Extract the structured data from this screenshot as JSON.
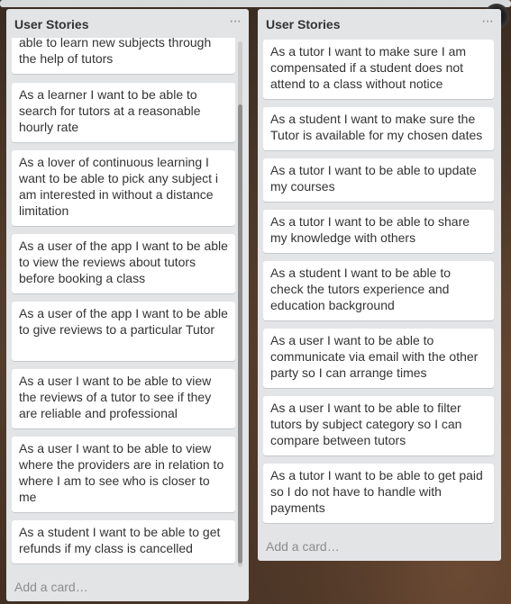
{
  "lists": [
    {
      "title": "User Stories",
      "menu": "···",
      "add_card": "Add a card…",
      "cards": [
        "able to learn new subjects through the help of tutors",
        "As a learner I want to be able to search for tutors at a reasonable hourly rate",
        "As a lover of continuous learning I want to be able to pick any subject i am interested in without a distance limitation",
        "As a user of the app I want to be able to view the reviews about tutors before booking a class",
        "As a user of the app I want to be able to give reviews to a particular Tutor",
        "As a user I want to be able to view the reviews of a tutor to see if they are reliable and professional",
        "As a user I want to be able to view where the providers are in relation to where I am to see who is closer to me",
        "As a student I want to be able to get refunds if my class is cancelled"
      ]
    },
    {
      "title": "User Stories",
      "menu": "···",
      "add_card": "Add a card…",
      "cards": [
        "As a tutor I want to make sure I am compensated if a student does not attend to a class without notice",
        "As a student I want to make sure the Tutor is available for my chosen dates",
        "As a tutor I want to be able to update my courses",
        "As a tutor I want to be able to share my knowledge with others",
        "As a student I want to be able to check the tutors experience and education background",
        "As a user I want to be able to communicate via email with the other party so I can arrange times",
        "As a user I want to be able to filter tutors by subject category so I can compare between tutors",
        "As a tutor I want to be able to get paid so I do not have to handle with payments"
      ]
    }
  ]
}
